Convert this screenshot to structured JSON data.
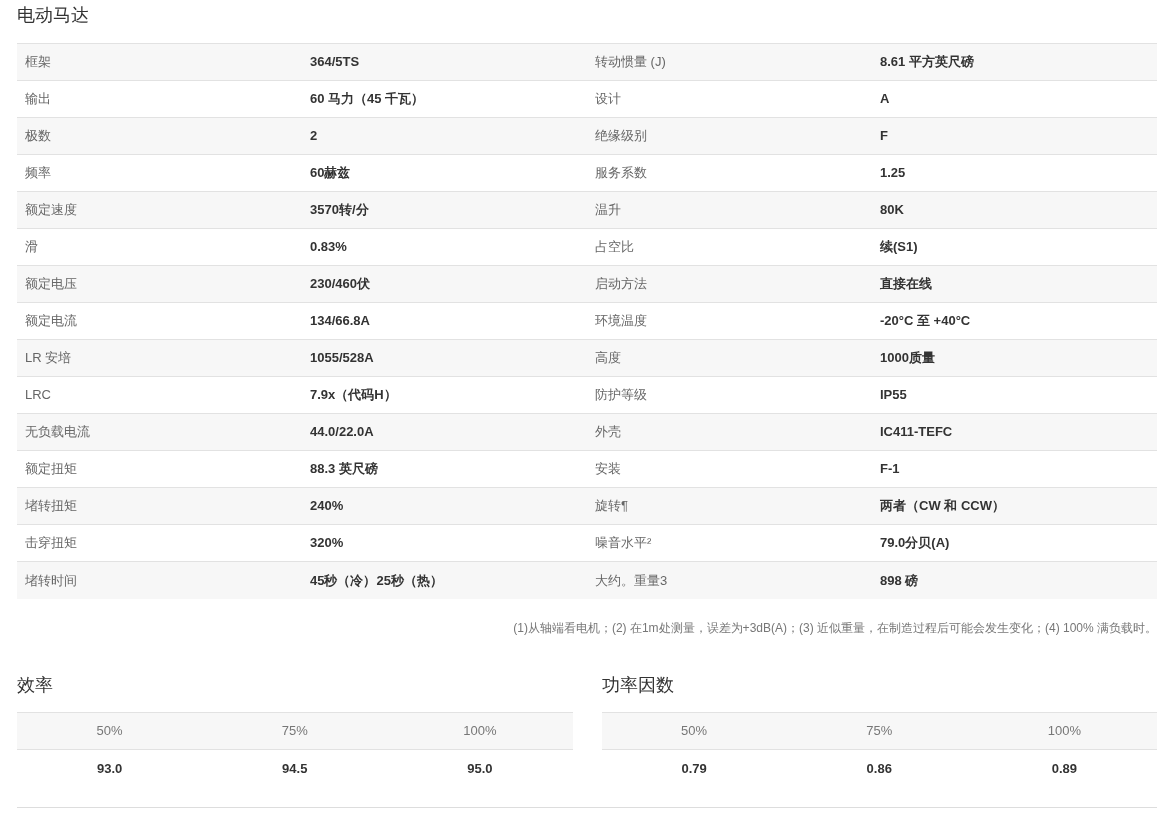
{
  "title": "电动马达",
  "specs": [
    [
      "框架",
      "364/5TS",
      "转动惯量 (J)",
      "8.61 平方英尺磅"
    ],
    [
      "输出",
      "60 马力（45 千瓦）",
      "设计",
      "A"
    ],
    [
      "极数",
      "2",
      "绝缘级别",
      "F"
    ],
    [
      "频率",
      "60赫兹",
      "服务系数",
      "1.25"
    ],
    [
      "额定速度",
      "3570转/分",
      "温升",
      "80K"
    ],
    [
      "滑",
      "0.83%",
      "占空比",
      "续(S1)"
    ],
    [
      "额定电压",
      "230/460伏",
      "启动方法",
      "直接在线"
    ],
    [
      "额定电流",
      "134/66.8A",
      "环境温度",
      "-20°C 至 +40°C"
    ],
    [
      "LR 安培",
      "1055/528A",
      "高度",
      "1000质量"
    ],
    [
      "LRC",
      "7.9x（代码H）",
      "防护等级",
      "IP55"
    ],
    [
      "无负载电流",
      "44.0/22.0A",
      "外壳",
      "IC411-TEFC"
    ],
    [
      "额定扭矩",
      "88.3 英尺磅",
      "安装",
      "F-1"
    ],
    [
      "堵转扭矩",
      "240%",
      "旋转¶",
      "两者（CW 和 CCW）"
    ],
    [
      "击穿扭矩",
      "320%",
      "噪音水平²",
      "79.0分贝(A)"
    ],
    [
      "堵转时间",
      "45秒（冷）25秒（热）",
      "大约。重量3",
      "898 磅"
    ]
  ],
  "footnote": "(1)从轴端看电机；(2) 在1m处测量，误差为+3dB(A)；(3) 近似重量，在制造过程后可能会发生变化；(4) 100% 满负载时。",
  "tables": [
    {
      "title": "效率",
      "columns": [
        "50%",
        "75%",
        "100%"
      ],
      "values": [
        "93.0",
        "94.5",
        "95.0"
      ]
    },
    {
      "title": "功率因数",
      "columns": [
        "50%",
        "75%",
        "100%"
      ],
      "values": [
        "0.79",
        "0.86",
        "0.89"
      ]
    }
  ]
}
